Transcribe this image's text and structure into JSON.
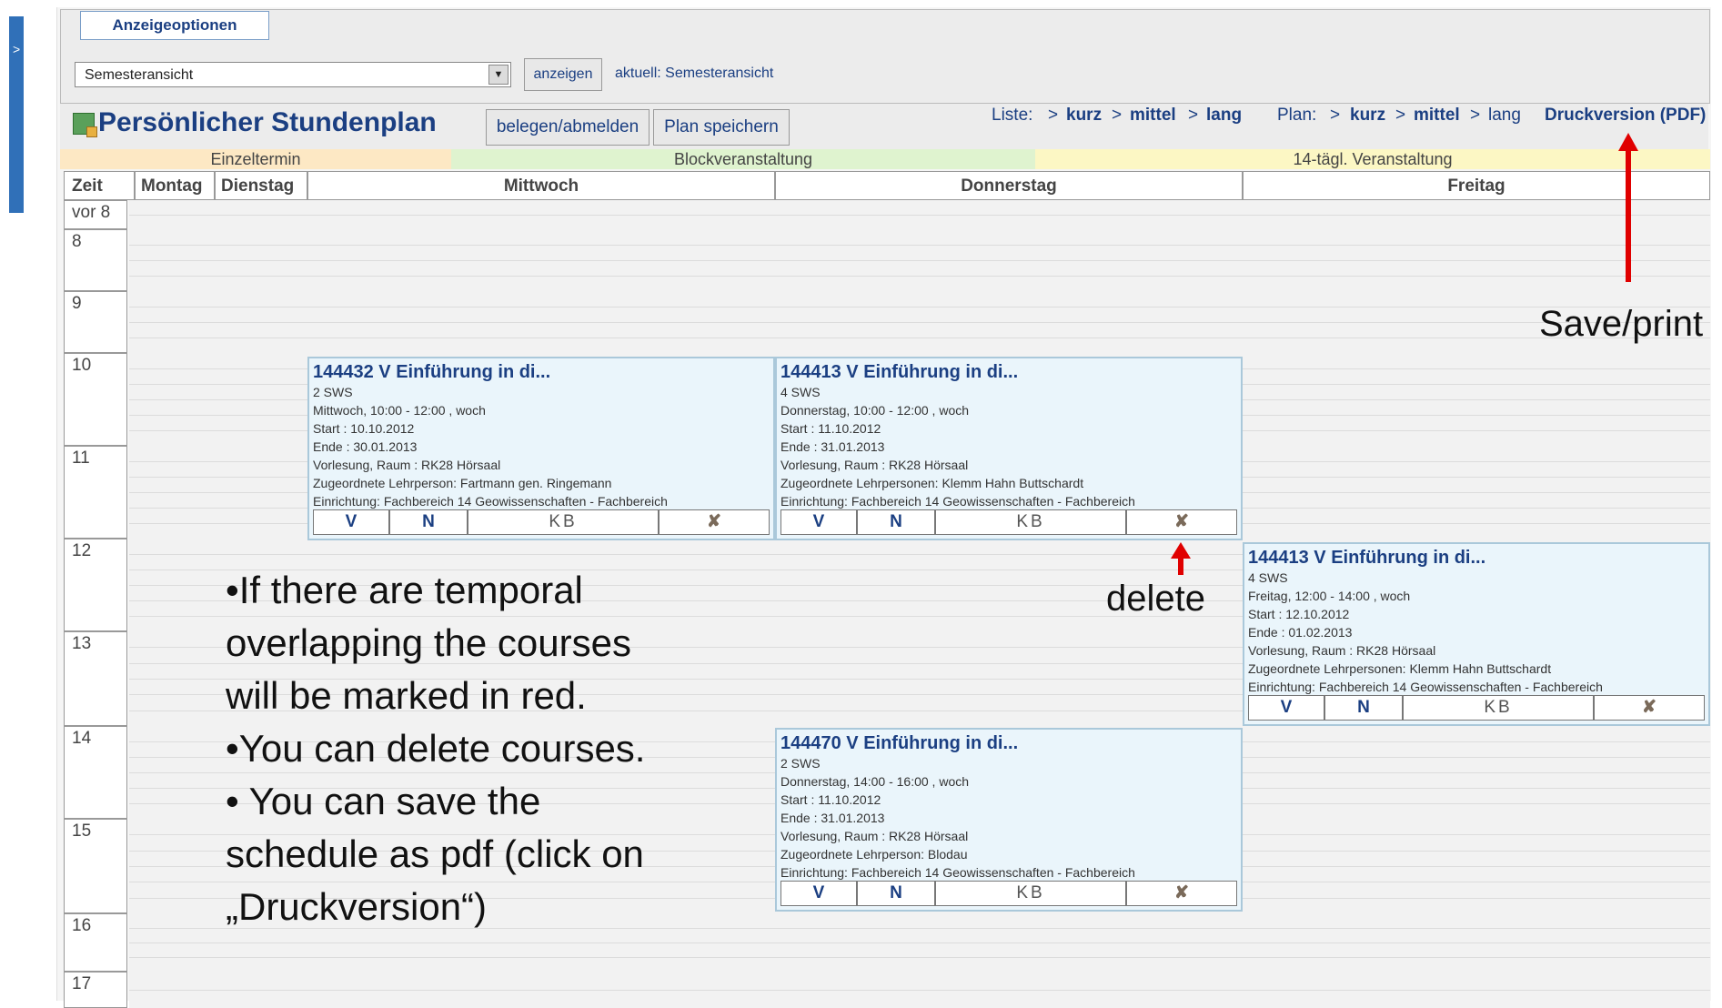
{
  "sidebar": {
    "toggle_label": ">"
  },
  "options": {
    "title": "Anzeigeoptionen",
    "view_select": "Semesteransicht",
    "show_button": "anzeigen",
    "current_view": "aktuell: Semesteransicht"
  },
  "header": {
    "title": "Persönlicher Stundenplan",
    "btn_belegen": "belegen/abmelden",
    "btn_speichern": "Plan speichern",
    "liste_label": "Liste:",
    "plan_label": "Plan:",
    "sep": ">",
    "kurz": "kurz",
    "mittel": "mittel",
    "lang": "lang",
    "druck": "Druckversion (PDF)"
  },
  "legend": {
    "einzeltermin": "Einzeltermin",
    "block": "Blockveranstaltung",
    "biweekly": "14-tägl. Veranstaltung"
  },
  "columns": {
    "zeit": "Zeit",
    "montag": "Montag",
    "dienstag": "Dienstag",
    "mittwoch": "Mittwoch",
    "donnerstag": "Donnerstag",
    "freitag": "Freitag"
  },
  "rows": [
    "vor 8",
    "8",
    "9",
    "10",
    "11",
    "12",
    "13",
    "14",
    "15",
    "16",
    "17"
  ],
  "courses": [
    {
      "title": "144432 V Einführung in di...",
      "sws": "2 SWS",
      "time": "Mittwoch,  10:00 - 12:00 , woch",
      "start": "Start :  10.10.2012",
      "end": "Ende :  30.01.2013",
      "room": "Vorlesung, Raum : RK28 Hörsaal",
      "teacher": "Zugeordnete Lehrperson: Fartmann gen. Ringemann",
      "inst": "Einrichtung: Fachbereich 14 Geowissenschaften - Fachbereich"
    },
    {
      "title": "144413 V Einführung in di...",
      "sws": "4 SWS",
      "time": "Donnerstag,  10:00 - 12:00 , woch",
      "start": "Start :  11.10.2012",
      "end": "Ende :  31.01.2013",
      "room": "Vorlesung, Raum : RK28 Hörsaal",
      "teacher": "Zugeordnete Lehrpersonen: Klemm  Hahn  Buttschardt",
      "inst": "Einrichtung: Fachbereich 14 Geowissenschaften - Fachbereich"
    },
    {
      "title": "144413 V Einführung in di...",
      "sws": "4 SWS",
      "time": "Freitag,  12:00 - 14:00 , woch",
      "start": "Start :  12.10.2012",
      "end": "Ende :  01.02.2013",
      "room": "Vorlesung, Raum : RK28 Hörsaal",
      "teacher": "Zugeordnete Lehrpersonen: Klemm  Hahn  Buttschardt",
      "inst": "Einrichtung: Fachbereich 14 Geowissenschaften - Fachbereich"
    },
    {
      "title": "144470 V Einführung in di...",
      "sws": "2 SWS",
      "time": "Donnerstag,  14:00 - 16:00 , woch",
      "start": "Start :  11.10.2012",
      "end": "Ende :  31.01.2013",
      "room": "Vorlesung, Raum : RK28 Hörsaal",
      "teacher": "Zugeordnete Lehrperson: Blodau",
      "inst": "Einrichtung: Fachbereich 14 Geowissenschaften - Fachbereich"
    }
  ],
  "course_bar": {
    "v": "V",
    "n": "N",
    "kb": "KB",
    "x": "✘"
  },
  "annotations": {
    "save_print": "Save/print",
    "delete": "delete",
    "lines": [
      "•If there are temporal",
      "overlapping the courses",
      "will be marked in red.",
      "•You can delete courses.",
      "• You can save the",
      "schedule as pdf (click on",
      "„Druckversion“)"
    ]
  },
  "colors": {
    "accent": "#1b3f82",
    "arrow": "#e00000",
    "course_bg": "#eaf5fb"
  }
}
